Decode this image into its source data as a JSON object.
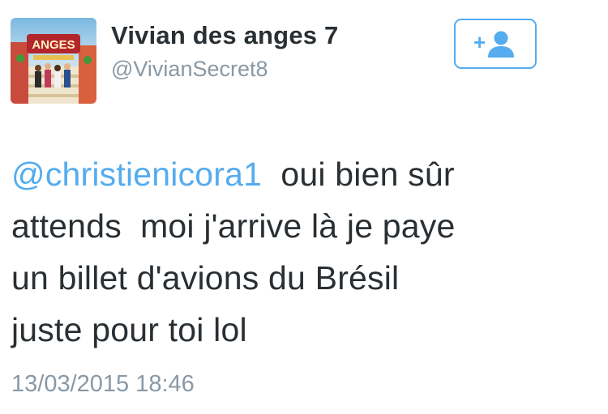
{
  "user": {
    "display_name": "Vivian des anges 7",
    "handle": "@VivianSecret8",
    "avatar_logo_text": "ANGES"
  },
  "follow_button": {
    "icon": "add-user-icon",
    "label": "+"
  },
  "tweet": {
    "mention": "@christienicora1",
    "lines": [
      "  oui bien sûr",
      "attends  moi j'arrive là je paye",
      "un billet d'avions du Brésil",
      "juste pour toi lol"
    ],
    "timestamp": "13/03/2015 18:46"
  },
  "colors": {
    "accent": "#55acee",
    "text": "#292f33",
    "muted": "#8899a6"
  }
}
